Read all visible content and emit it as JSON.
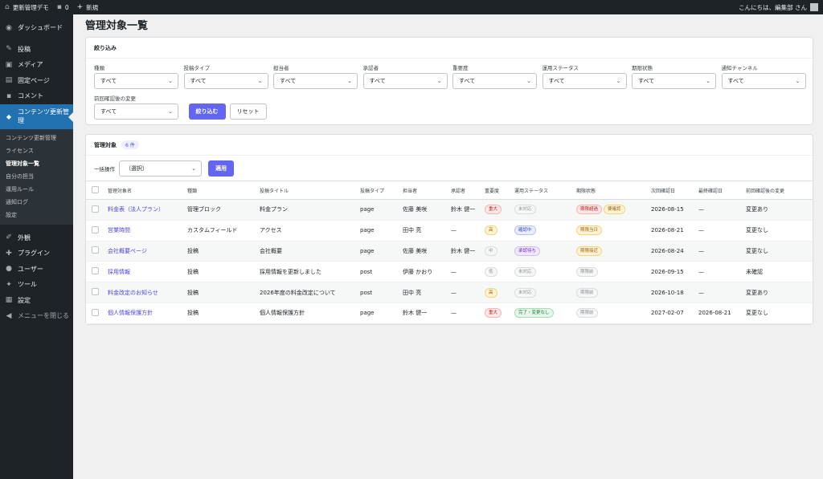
{
  "adminbar": {
    "site": "更新管理デモ",
    "comments": "0",
    "new": "新規",
    "greeting": "こんにちは、編集部 さん"
  },
  "sidebar": {
    "dashboard": "ダッシュボード",
    "posts": "投稿",
    "media": "メディア",
    "pages": "固定ページ",
    "comments": "コメント",
    "active": "コンテンツ更新管理",
    "submenu": [
      "コンテンツ更新管理",
      "ライセンス",
      "管理対象一覧",
      "自分の担当",
      "運用ルール",
      "通知ログ",
      "設定"
    ],
    "appearance": "外観",
    "plugins": "プラグイン",
    "users": "ユーザー",
    "tools": "ツール",
    "settings": "設定",
    "collapse": "メニューを閉じる"
  },
  "page": {
    "title": "管理対象一覧"
  },
  "filter": {
    "title": "絞り込み",
    "fields": [
      {
        "label": "種類",
        "value": "すべて"
      },
      {
        "label": "投稿タイプ",
        "value": "すべて"
      },
      {
        "label": "担当者",
        "value": "すべて"
      },
      {
        "label": "承認者",
        "value": "すべて"
      },
      {
        "label": "重要度",
        "value": "すべて"
      },
      {
        "label": "運用ステータス",
        "value": "すべて"
      },
      {
        "label": "期限状態",
        "value": "すべて"
      },
      {
        "label": "通知チャンネル",
        "value": "すべて"
      },
      {
        "label": "前回確認後の変更",
        "value": "すべて"
      }
    ],
    "apply": "絞り込む",
    "reset": "リセット"
  },
  "list": {
    "title": "管理対象",
    "count": "6 件",
    "bulk_label": "一括操作",
    "bulk_value": "（選択）",
    "bulk_apply": "適用",
    "headers": [
      "管理対象名",
      "種類",
      "投稿タイトル",
      "投稿タイプ",
      "担当者",
      "承認者",
      "重要度",
      "運用ステータス",
      "期限状態",
      "次回確認日",
      "最終確認日",
      "前回確認後の変更"
    ],
    "rows": [
      {
        "name": "料金表（法人プラン）",
        "kind": "管理ブロック",
        "title": "料金プラン",
        "type": "page",
        "owner": "佐藤 美咲",
        "approver": "鈴木 健一",
        "importance": "重大",
        "status": "未対応",
        "deadline": [
          "期限超過",
          "要確認"
        ],
        "next": "2026-08-15",
        "last": "—",
        "change": "変更あり"
      },
      {
        "name": "営業時間",
        "kind": "カスタムフィールド",
        "title": "アクセス",
        "type": "page",
        "owner": "田中 亮",
        "approver": "—",
        "importance": "高",
        "status": "確認中",
        "deadline": [
          "期限当日"
        ],
        "next": "2026-08-21",
        "last": "—",
        "change": "変更なし"
      },
      {
        "name": "会社概要ページ",
        "kind": "投稿",
        "title": "会社概要",
        "type": "page",
        "owner": "佐藤 美咲",
        "approver": "鈴木 健一",
        "importance": "中",
        "status": "承認待ち",
        "deadline": [
          "期限接近"
        ],
        "next": "2026-08-24",
        "last": "—",
        "change": "変更なし"
      },
      {
        "name": "採用情報",
        "kind": "投稿",
        "title": "採用情報を更新しました",
        "type": "post",
        "owner": "伊藤 かおり",
        "approver": "—",
        "importance": "低",
        "status": "未対応",
        "deadline": [
          "期限前"
        ],
        "next": "2026-09-15",
        "last": "—",
        "change": "未確認"
      },
      {
        "name": "料金改定のお知らせ",
        "kind": "投稿",
        "title": "2026年度の料金改定について",
        "type": "post",
        "owner": "田中 亮",
        "approver": "—",
        "importance": "高",
        "status": "未対応",
        "deadline": [
          "期限前"
        ],
        "next": "2026-10-18",
        "last": "—",
        "change": "変更あり"
      },
      {
        "name": "個人情報保護方針",
        "kind": "投稿",
        "title": "個人情報保護方針",
        "type": "page",
        "owner": "鈴木 健一",
        "approver": "—",
        "importance": "重大",
        "status": "完了・変更なし",
        "deadline": [
          "期限前"
        ],
        "next": "2027-02-07",
        "last": "2026-08-21",
        "change": "変更なし"
      }
    ]
  },
  "colors": {
    "accent": "#6366f1",
    "sidebar": "#1d2327",
    "active_menu": "#2271b1",
    "link": "#4f46e5"
  }
}
